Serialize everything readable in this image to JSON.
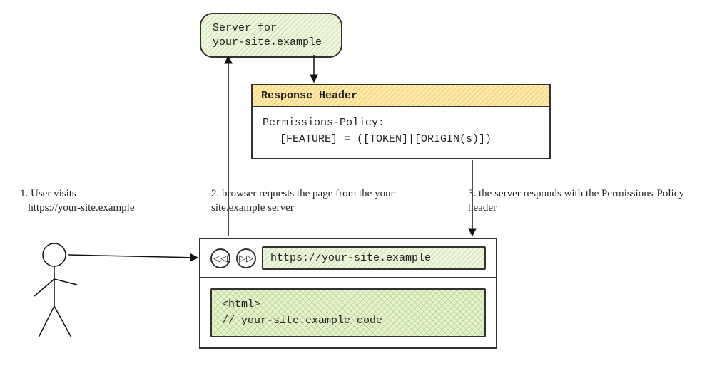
{
  "server": {
    "line1": "Server for",
    "line2": "your-site.example"
  },
  "response": {
    "title": "Response Header",
    "policy_header": "Permissions-Policy:",
    "policy_value": "[FEATURE] = ([TOKEN]|[ORIGIN(s)])"
  },
  "labels": {
    "step1_prefix": "1. User visits",
    "step1_url": "https://your-site.example",
    "step2": "2. browser requests the page from the your-site.example server",
    "step3": "3. the server responds with the Permissions-Policy header"
  },
  "browser": {
    "url": "https://your-site.example",
    "code_line1": "<html>",
    "code_line2": "// your-site.example code",
    "back_icon": "◁◁",
    "fwd_icon": "▷▷"
  }
}
